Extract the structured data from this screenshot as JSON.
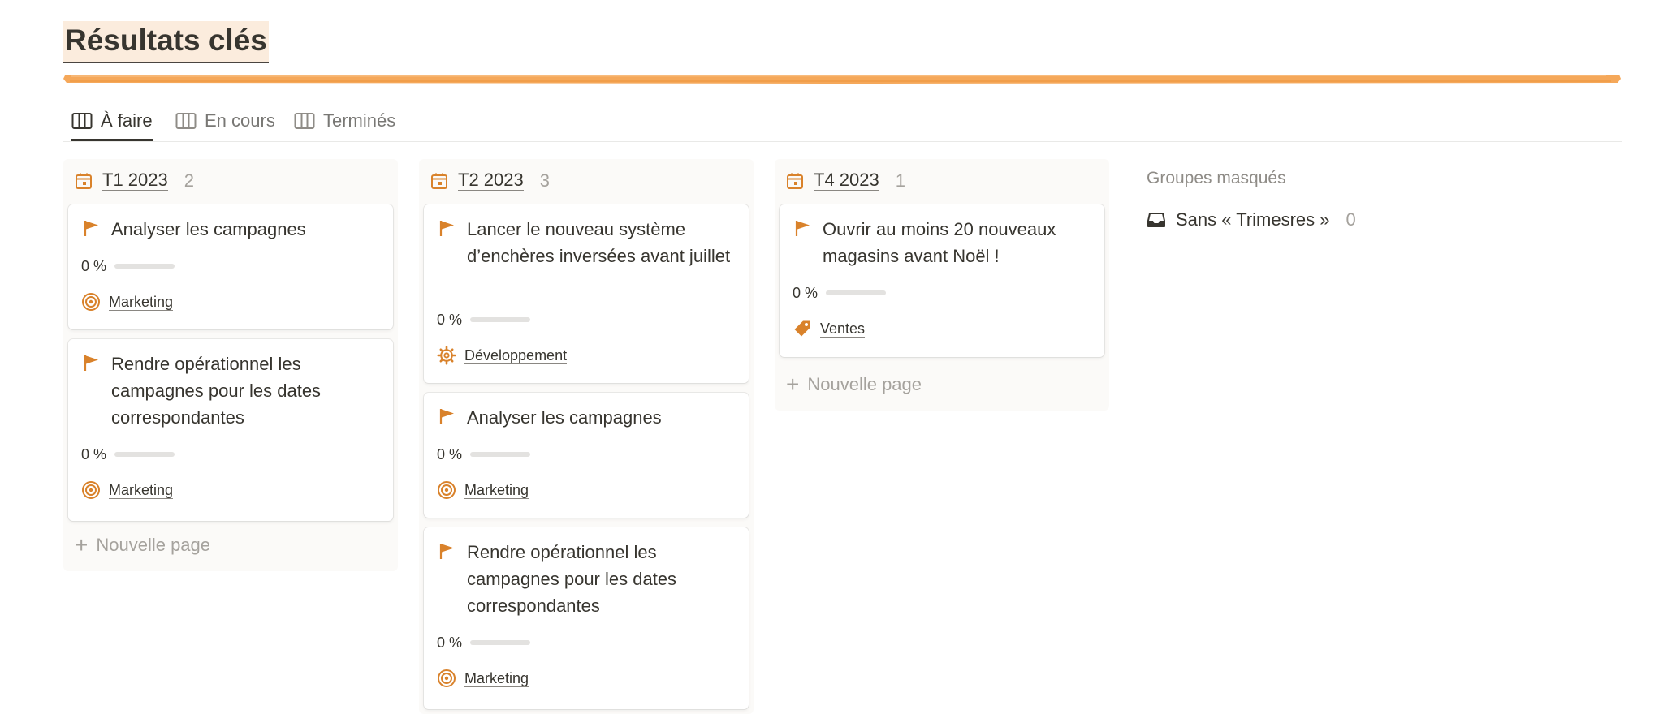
{
  "page": {
    "title": "Résultats clés"
  },
  "tabs": [
    {
      "label": "À faire",
      "active": true
    },
    {
      "label": "En cours",
      "active": false
    },
    {
      "label": "Terminés",
      "active": false
    }
  ],
  "columns": [
    {
      "title": "T1 2023",
      "count": "2",
      "cards": [
        {
          "title": "Analyser les campagnes",
          "progress": "0 %",
          "progress_value": 0,
          "tag": "Marketing",
          "tag_icon": "target-icon"
        },
        {
          "title": "Rendre opérationnel les campagnes pour les dates correspondantes",
          "progress": "0 %",
          "progress_value": 0,
          "tag": "Marketing",
          "tag_icon": "target-icon"
        }
      ],
      "new_page": "Nouvelle page"
    },
    {
      "title": "T2 2023",
      "count": "3",
      "cards": [
        {
          "title": "Lancer le nouveau système d’enchères inversées avant juillet",
          "progress": "0 %",
          "progress_value": 0,
          "tag": "Développement",
          "tag_icon": "gear-icon"
        },
        {
          "title": "Analyser les campagnes",
          "progress": "0 %",
          "progress_value": 0,
          "tag": "Marketing",
          "tag_icon": "target-icon"
        },
        {
          "title": "Rendre opérationnel les campagnes pour les dates correspondantes",
          "progress": "0 %",
          "progress_value": 0,
          "tag": "Marketing",
          "tag_icon": "target-icon"
        }
      ]
    },
    {
      "title": "T4 2023",
      "count": "1",
      "cards": [
        {
          "title": "Ouvrir au moins 20 nouveaux magasins avant Noël !",
          "progress": "0 %",
          "progress_value": 0,
          "tag": "Ventes",
          "tag_icon": "price-tag-icon"
        }
      ],
      "new_page": "Nouvelle page"
    }
  ],
  "hidden_groups": {
    "title": "Groupes masqués",
    "items": [
      {
        "label": "Sans « Trimesres »",
        "count": "0"
      }
    ]
  },
  "colors": {
    "accent": "#d9822b",
    "brush": "#f5a85a",
    "title_highlight": "#fbecdd"
  }
}
